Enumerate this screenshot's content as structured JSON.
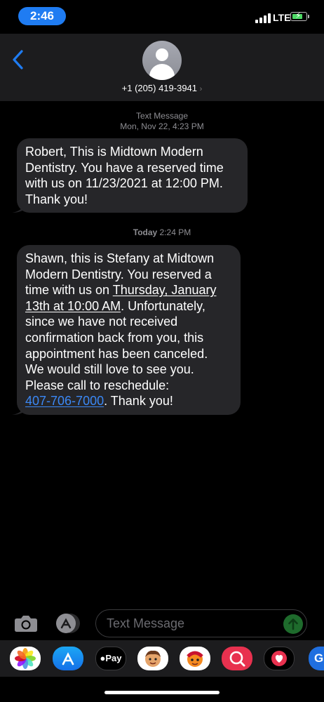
{
  "status_bar": {
    "time": "2:46",
    "network": "LTE",
    "time_pill_color": "#1f7cf2"
  },
  "header": {
    "contact": "+1 (205) 419-3941",
    "chevron": "›",
    "accent_color": "#1f7cf2"
  },
  "messages": [
    {
      "meta_label": "Text Message",
      "meta_time": "Mon, Nov 22, 4:23 PM",
      "lines": [
        "Robert, This is Midtown Modern",
        "Dentistry. You have a reserved time",
        "with us on 11/23/2021 at 12:00 PM.",
        "Thank you!"
      ]
    },
    {
      "meta_day": "Today",
      "meta_time": "2:24 PM",
      "line_1": "Shawn, this is Stefany at Midtown",
      "line_2": "Modern Dentistry. You reserved a",
      "line_3_pre": "time with us on ",
      "date_1": "Thursday, January",
      "date_2": "13th at 10:00 AM",
      "line_4_post": ". Unfortunately,",
      "line_5": "since we have not received",
      "line_6": "confirmation back from you, this",
      "line_7": "appointment has been canceled.",
      "line_8": "We would still love to see you.",
      "line_9": "Please call to reschedule:",
      "phone": "407-706-7000",
      "line_10_post": ". Thank you!",
      "link_color": "#3b88f5"
    }
  ],
  "composer": {
    "placeholder": "Text Message"
  },
  "app_drawer": {
    "apps": [
      "photos-icon",
      "app-store-icon",
      "apple-pay-icon",
      "memoji-icon",
      "animoji-icon",
      "image-search-icon",
      "digital-touch-icon",
      "google-icon"
    ],
    "apple_pay_label": "Pay",
    "google_label": "G"
  }
}
